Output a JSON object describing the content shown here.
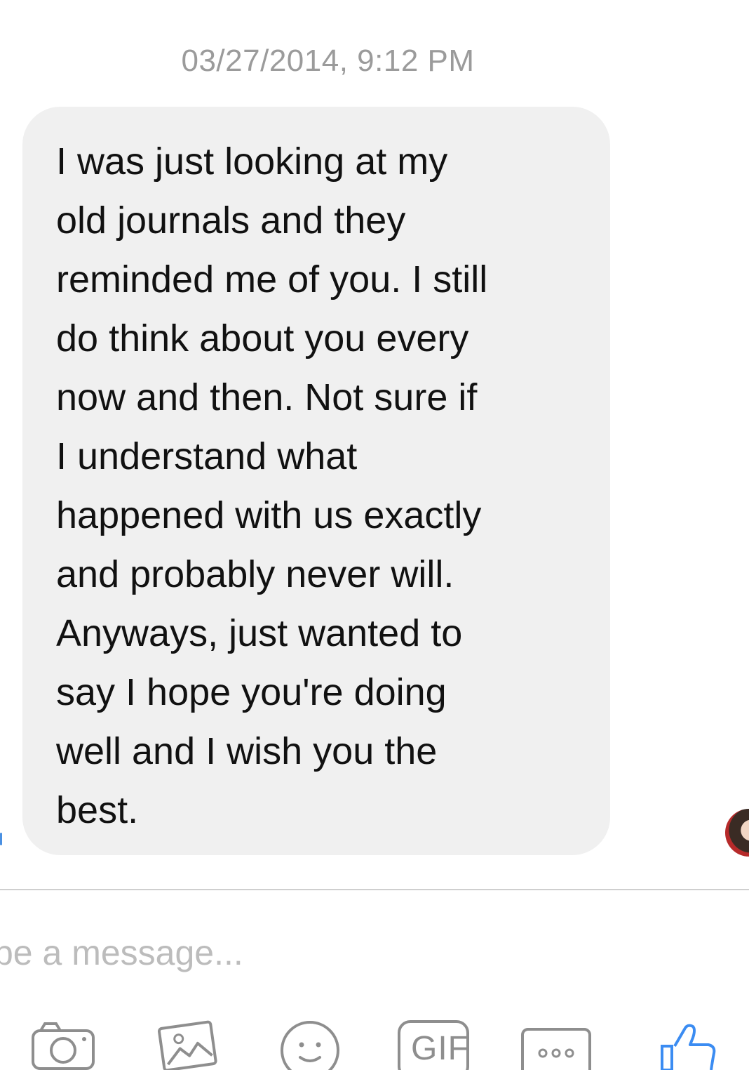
{
  "header": {
    "timestamp": "03/27/2014, 9:12 PM"
  },
  "message": {
    "lines": [
      "I was just looking at my",
      "old journals and they",
      "reminded me of you. I still",
      "do think about you every",
      "now and then. Not sure if",
      "I understand what",
      "happened with us exactly",
      "and probably never will.",
      "Anyways, just wanted to",
      "say I hope you're doing",
      "well and I wish you the",
      "best."
    ]
  },
  "composer": {
    "placeholder": "ype a message..."
  },
  "toolbar": {
    "icons": [
      "camera-icon",
      "photo-icon",
      "emoji-icon",
      "gif-icon",
      "more-icon",
      "like-icon"
    ],
    "gif_label": "GIF"
  },
  "colors": {
    "accent": "#3b8cf2",
    "bubble": "#f0f0f0",
    "icon_gray": "#8e8e8e"
  }
}
